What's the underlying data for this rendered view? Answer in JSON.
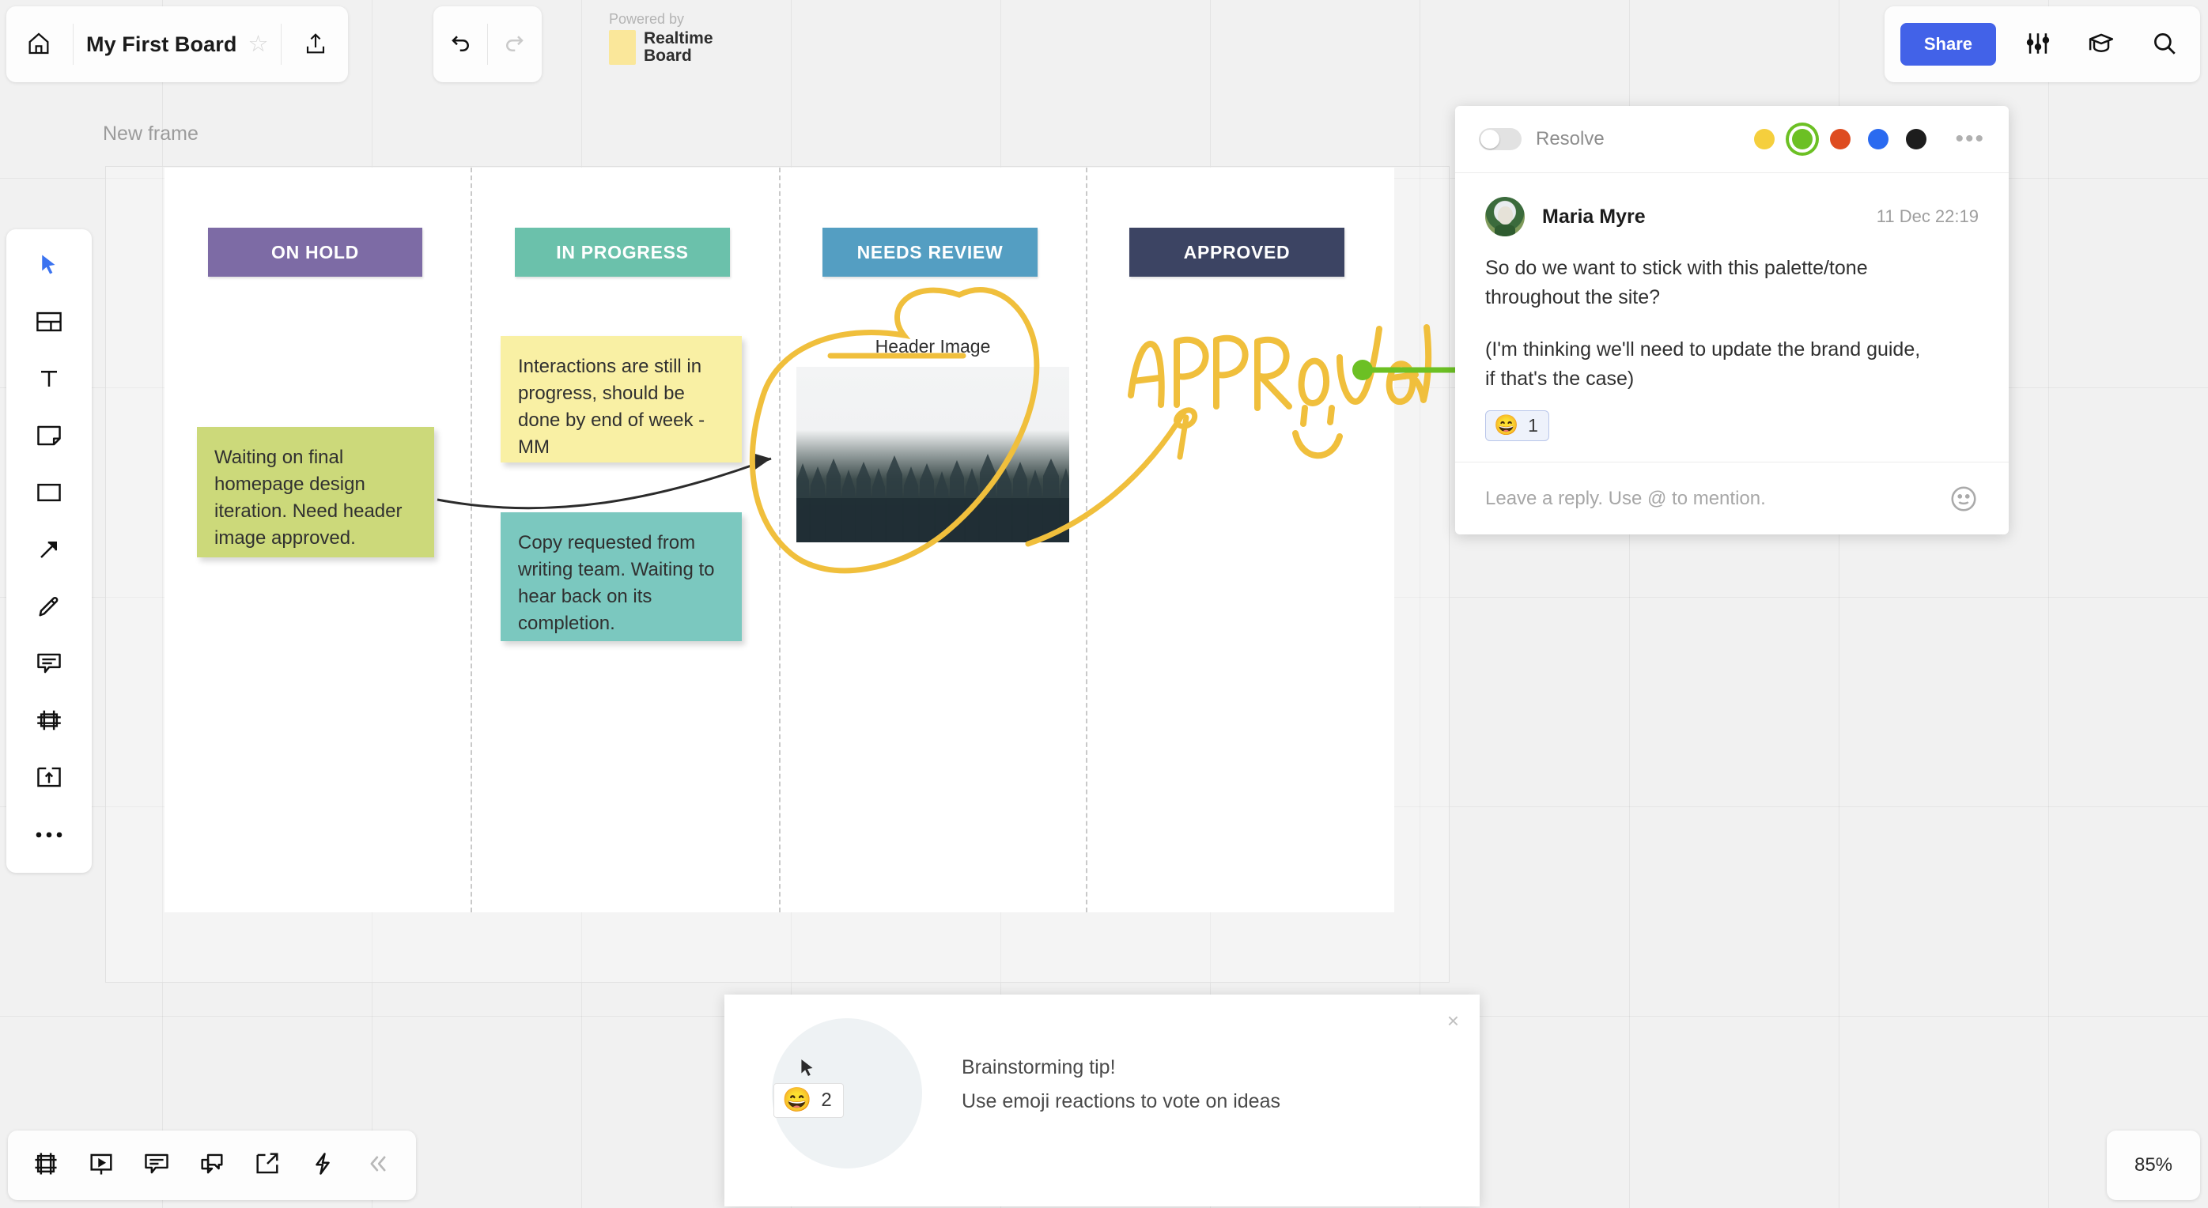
{
  "app": {
    "board_title": "My First Board",
    "powered_by_label": "Powered by",
    "brand_name_line1": "Realtime",
    "brand_name_line2": "Board",
    "share_label": "Share",
    "zoom_level": "85%",
    "frame_label": "New frame",
    "accent_blue": "#4262e8",
    "ink_yellow": "#f0bf3c",
    "connector_green": "#6cc024"
  },
  "topbar": {
    "home_icon": "home-icon",
    "star_glyph": "☆",
    "upload_icon": "upload-icon",
    "undo_icon": "undo-arrow-icon",
    "redo_icon": "redo-arrow-icon",
    "settings_icon": "sliders-icon",
    "learn_icon": "graduation-cap-icon",
    "search_icon": "magnifier-icon"
  },
  "left_toolbar": {
    "items": [
      {
        "name": "cursor-select-tool",
        "icon": "cursor-arrow-icon",
        "active": true
      },
      {
        "name": "template-tool",
        "icon": "template-grid-icon",
        "active": false
      },
      {
        "name": "text-tool",
        "icon": "text-t-icon",
        "active": false
      },
      {
        "name": "sticky-note-tool",
        "icon": "sticky-note-icon",
        "active": false
      },
      {
        "name": "shape-tool",
        "icon": "rectangle-icon",
        "active": false
      },
      {
        "name": "line-tool",
        "icon": "arrow-diagonal-icon",
        "active": false
      },
      {
        "name": "pen-tool",
        "icon": "pencil-icon",
        "active": false
      },
      {
        "name": "comment-tool",
        "icon": "comment-bubble-icon",
        "active": false
      },
      {
        "name": "frame-tool",
        "icon": "frame-crop-icon",
        "active": false
      },
      {
        "name": "upload-tool",
        "icon": "upload-box-icon",
        "active": false
      },
      {
        "name": "more-tools",
        "icon": "ellipsis-icon",
        "active": false
      }
    ]
  },
  "bottom_toolbar": {
    "items": [
      {
        "name": "frames-panel-button",
        "icon": "frames-icon"
      },
      {
        "name": "presentation-button",
        "icon": "presentation-icon"
      },
      {
        "name": "comments-panel-button",
        "icon": "comment-lines-icon"
      },
      {
        "name": "chat-button",
        "icon": "chat-bubbles-icon"
      },
      {
        "name": "export-button",
        "icon": "export-arrow-icon"
      },
      {
        "name": "integrations-button",
        "icon": "lightning-bolt-icon"
      },
      {
        "name": "collapse-button",
        "icon": "chevron-double-left-icon"
      }
    ]
  },
  "board": {
    "columns": [
      {
        "title": "ON HOLD",
        "color": "#7d6ba5"
      },
      {
        "title": "IN PROGRESS",
        "color": "#6bc1ab"
      },
      {
        "title": "NEEDS REVIEW",
        "color": "#549ec2"
      },
      {
        "title": "APPROVED",
        "color": "#3c4463"
      }
    ],
    "stickies": [
      {
        "text": "Waiting on final homepage design iteration. Need header image approved.",
        "color": "#ccd97a",
        "column": "ON HOLD"
      },
      {
        "text": "Interactions are still in progress, should be done by end of week - MM",
        "color": "#f9f0a4",
        "column": "IN PROGRESS"
      },
      {
        "text": "Copy requested from writing team. Waiting to hear back on its completion.",
        "color": "#7bc8bf",
        "column": "IN PROGRESS"
      }
    ],
    "image_widget": {
      "caption": "Header Image",
      "alt": "misty evergreen forest photo"
    },
    "annotation": {
      "handwritten_text": "APPRoved",
      "smiley": "drawn-smiley-face"
    }
  },
  "comment_panel": {
    "resolve_label": "Resolve",
    "resolve_on": false,
    "color_dots": [
      {
        "name": "yellow",
        "hex": "#f5cf3d",
        "selected": false
      },
      {
        "name": "green",
        "hex": "#6cc024",
        "selected": true
      },
      {
        "name": "red",
        "hex": "#de4c20",
        "selected": false
      },
      {
        "name": "blue",
        "hex": "#2a6af0",
        "selected": false
      },
      {
        "name": "black",
        "hex": "#1d1d1d",
        "selected": false
      }
    ],
    "more_glyph": "•••",
    "author": "Maria Myre",
    "timestamp": "11 Dec 22:19",
    "message_paragraph_1": "So do we want to stick with this palette/tone throughout the site?",
    "message_paragraph_2": "(I'm thinking we'll need to update the brand guide, if that's the case)",
    "reaction": {
      "emoji": "😄",
      "count": "1"
    },
    "reply_placeholder": "Leave a reply. Use @ to mention."
  },
  "tip_popup": {
    "close_glyph": "×",
    "chip": {
      "emoji": "😄",
      "count": "2"
    },
    "title": "Brainstorming tip!",
    "body": "Use emoji reactions to vote on ideas"
  }
}
